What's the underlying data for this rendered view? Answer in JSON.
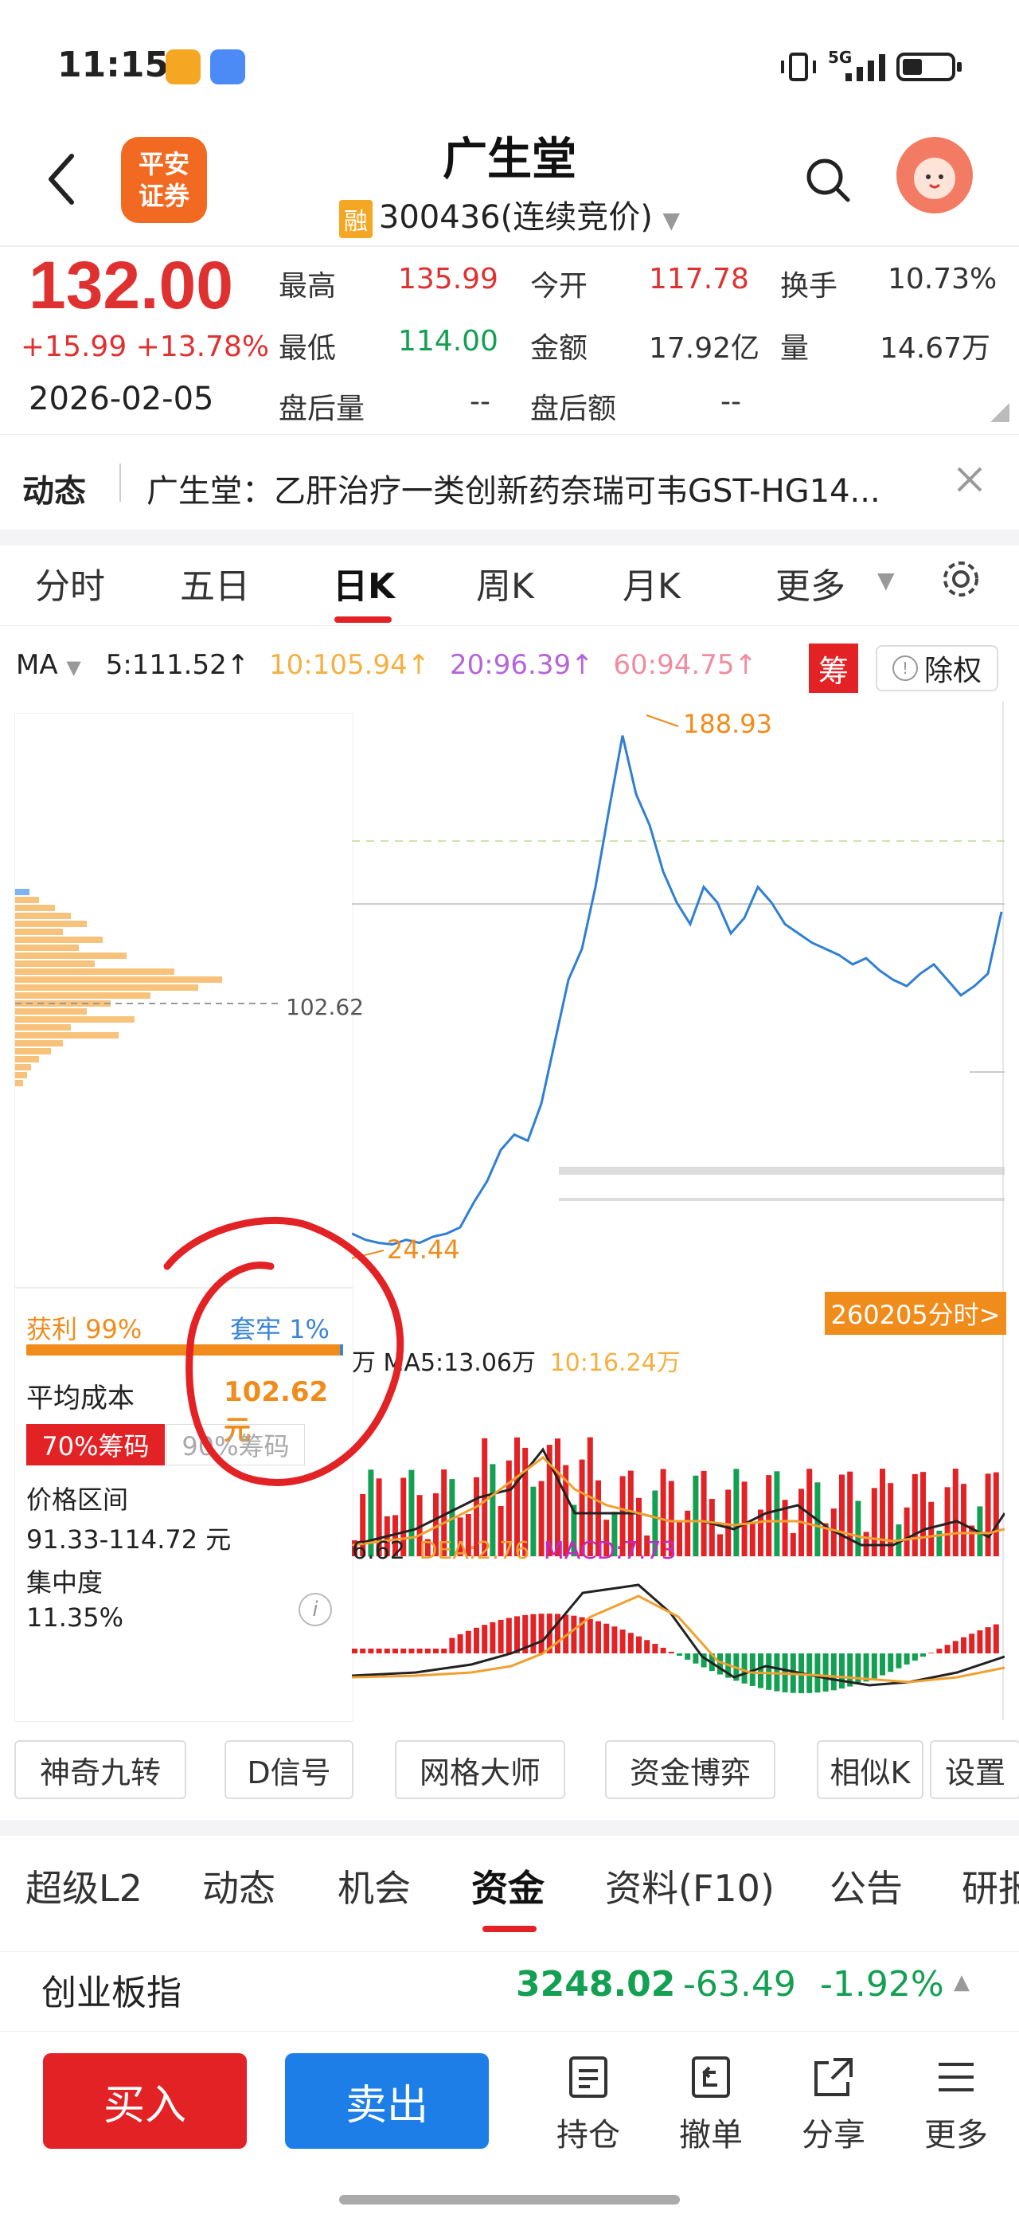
{
  "status_bar": {
    "time": "11:15",
    "network": "5G"
  },
  "header": {
    "broker_logo_line1": "平安",
    "broker_logo_line2": "证券",
    "stock_name": "广生堂",
    "margin_badge": "融",
    "code_line": "300436(连续竞价)"
  },
  "quote": {
    "price": "132.00",
    "change": "+15.99 +13.78%",
    "date": "2026-02-05",
    "high_label": "最高",
    "high": "135.99",
    "open_label": "今开",
    "open": "117.78",
    "turnover_label": "换手",
    "turnover": "10.73%",
    "low_label": "最低",
    "low": "114.00",
    "amount_label": "金额",
    "amount": "17.92亿",
    "volume_label": "量",
    "volume": "14.67万",
    "after_vol_label": "盘后量",
    "after_vol": "--",
    "after_amt_label": "盘后额",
    "after_amt": "--"
  },
  "news": {
    "label": "动态",
    "text": "广生堂：乙肝治疗一类创新药奈瑞可韦GST-HG14..."
  },
  "kline_tabs": [
    "分时",
    "五日",
    "日K",
    "周K",
    "月K",
    "更多"
  ],
  "active_kline_tab": "日K",
  "ma": {
    "label": "MA",
    "ma5": "5:111.52↑",
    "ma10": "10:105.94↑",
    "ma20": "20:96.39↑",
    "ma60": "60:94.75↑",
    "chip_badge": "筹",
    "exright": "除权"
  },
  "chip_panel": {
    "cost_marker": "102.62",
    "profit": "获利 99%",
    "trapped": "套牢 1%",
    "avg_cost_label": "平均成本",
    "avg_cost": "102.62元",
    "chip70": "70%筹码",
    "chip90": "90%筹码",
    "range_label": "价格区间",
    "range": "91.33-114.72 元",
    "concentration_label": "集中度",
    "concentration": "11.35%"
  },
  "main_chart": {
    "high_label": "188.93",
    "low_label": "24.44",
    "intraday_button": "260205分时>",
    "vol_line": "万 MA5:13.06万",
    "vol_ma10": "10:16.24万",
    "macd_dif": "6.62",
    "macd_dea": "DEA:2.76",
    "macd_val": "MACD:7.73"
  },
  "chart_data": {
    "type": "line",
    "title": "",
    "series": [
      {
        "values": [
          28,
          26,
          25,
          24.5,
          26,
          25,
          27,
          28,
          30,
          38,
          45,
          55,
          60,
          58,
          70,
          90,
          110,
          120,
          140,
          165,
          188.93,
          170,
          160,
          145,
          135,
          128,
          140,
          135,
          125,
          130,
          140,
          135,
          128,
          125,
          122,
          120,
          118,
          115,
          117,
          113,
          110,
          108,
          112,
          115,
          110,
          105,
          108,
          112,
          132
        ]
      }
    ],
    "ylim": [
      20,
      195
    ],
    "grid": false
  },
  "tools": [
    "神奇九转",
    "D信号",
    "网格大师",
    "资金博弈",
    "相似K",
    "设置"
  ],
  "section_tabs": [
    "超级L2",
    "动态",
    "机会",
    "资金",
    "资料(F10)",
    "公告",
    "研报"
  ],
  "active_section_tab": "资金",
  "index": {
    "name": "创业板指",
    "value": "3248.02",
    "change": "-63.49",
    "pct": "-1.92%"
  },
  "bottom": {
    "buy": "买入",
    "sell": "卖出",
    "holdings": "持仓",
    "cancel": "撤单",
    "share": "分享",
    "more": "更多"
  },
  "colors": {
    "up": "#e03131",
    "down": "#14a052",
    "accent_orange": "#f08c1c",
    "buy": "#e32226",
    "sell": "#1e7ee8"
  }
}
